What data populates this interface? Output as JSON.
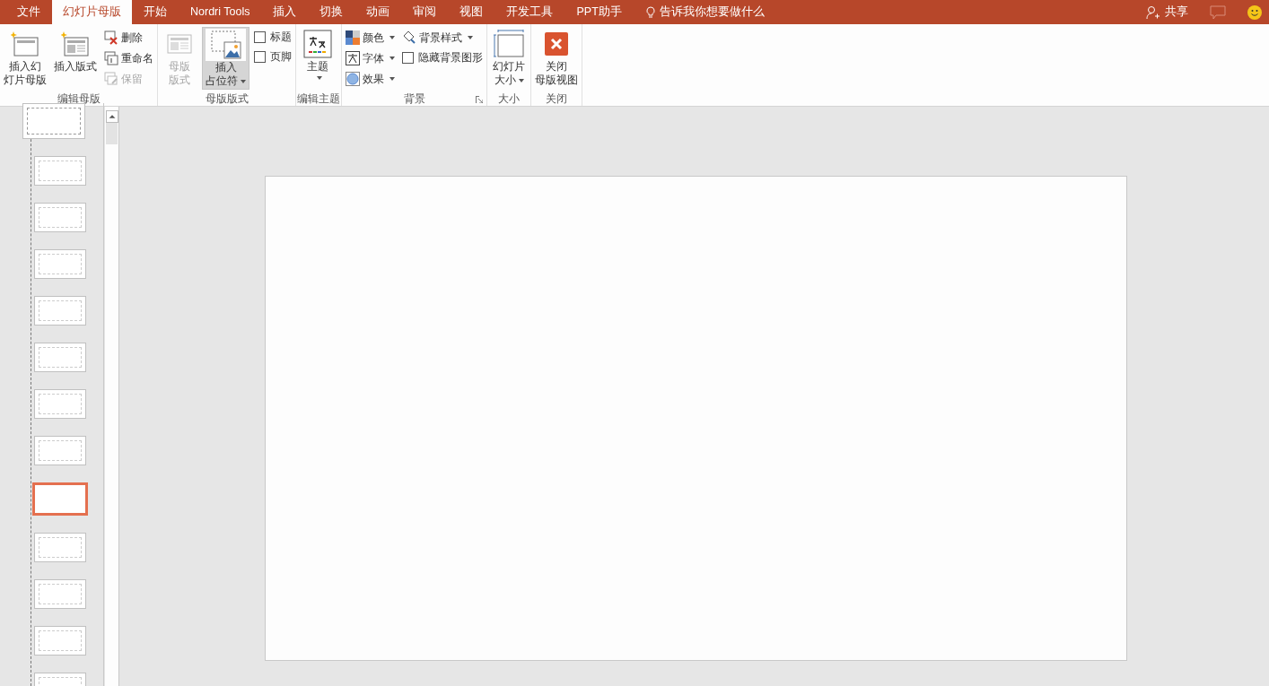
{
  "tabs": [
    {
      "label": "文件",
      "selected": false
    },
    {
      "label": "幻灯片母版",
      "selected": true
    },
    {
      "label": "开始",
      "selected": false
    },
    {
      "label": "Nordri Tools",
      "selected": false
    },
    {
      "label": "插入",
      "selected": false
    },
    {
      "label": "切换",
      "selected": false
    },
    {
      "label": "动画",
      "selected": false
    },
    {
      "label": "审阅",
      "selected": false
    },
    {
      "label": "视图",
      "selected": false
    },
    {
      "label": "开发工具",
      "selected": false
    },
    {
      "label": "PPT助手",
      "selected": false
    }
  ],
  "tell_me": "告诉我你想要做什么",
  "share": "共享",
  "ribbon_groups": [
    {
      "label": "编辑母版",
      "columns": [
        [
          {
            "kind": "large",
            "lines": [
              "插入幻",
              "灯片母版"
            ],
            "disabled": false,
            "dropdown": false,
            "pressed": false
          }
        ],
        [
          {
            "kind": "large",
            "lines": [
              "插入版式"
            ],
            "disabled": false,
            "dropdown": false,
            "pressed": false
          }
        ],
        [
          {
            "kind": "small",
            "label": "删除",
            "disabled": false,
            "dropdown": false
          },
          {
            "kind": "small",
            "label": "重命名",
            "disabled": false,
            "dropdown": false
          },
          {
            "kind": "small",
            "label": "保留",
            "disabled": true,
            "dropdown": false
          }
        ]
      ]
    },
    {
      "label": "母版版式",
      "columns": [
        [
          {
            "kind": "large",
            "lines": [
              "母版",
              "版式"
            ],
            "disabled": true,
            "dropdown": false,
            "pressed": false
          }
        ],
        [
          {
            "kind": "large",
            "lines": [
              "插入",
              "占位符"
            ],
            "disabled": false,
            "dropdown": true,
            "pressed": true
          }
        ],
        [
          {
            "kind": "check",
            "label": "标题",
            "checked": false
          },
          {
            "kind": "check",
            "label": "页脚",
            "checked": false
          }
        ]
      ]
    },
    {
      "label": "编辑主题",
      "columns": [
        [
          {
            "kind": "large",
            "lines": [
              "主题"
            ],
            "disabled": false,
            "dropdown": true,
            "pressed": false
          }
        ]
      ]
    },
    {
      "label": "背景",
      "launcher": true,
      "columns": [
        [
          {
            "kind": "small",
            "label": "颜色",
            "disabled": false,
            "dropdown": true
          },
          {
            "kind": "small",
            "label": "字体",
            "disabled": false,
            "dropdown": true
          },
          {
            "kind": "small",
            "label": "效果",
            "disabled": false,
            "dropdown": true
          }
        ],
        [
          {
            "kind": "small",
            "label": "背景样式",
            "disabled": false,
            "dropdown": true
          },
          {
            "kind": "check",
            "label": "隐藏背景图形",
            "checked": false
          }
        ]
      ]
    },
    {
      "label": "大小",
      "columns": [
        [
          {
            "kind": "large",
            "lines": [
              "幻灯片",
              "大小"
            ],
            "disabled": false,
            "dropdown": true,
            "pressed": false
          }
        ]
      ]
    },
    {
      "label": "关闭",
      "columns": [
        [
          {
            "kind": "large",
            "lines": [
              "关闭",
              "母版视图"
            ],
            "disabled": false,
            "dropdown": false,
            "pressed": false
          }
        ]
      ]
    }
  ],
  "thumbnails": [
    {
      "kind": "master",
      "selected": false
    },
    {
      "kind": "layout",
      "selected": false
    },
    {
      "kind": "layout",
      "selected": false
    },
    {
      "kind": "layout",
      "selected": false
    },
    {
      "kind": "layout",
      "selected": false
    },
    {
      "kind": "layout",
      "selected": false
    },
    {
      "kind": "layout",
      "selected": false
    },
    {
      "kind": "layout",
      "selected": false
    },
    {
      "kind": "layout",
      "selected": true
    },
    {
      "kind": "layout",
      "selected": false
    },
    {
      "kind": "layout",
      "selected": false
    },
    {
      "kind": "layout",
      "selected": false
    },
    {
      "kind": "layout",
      "selected": false
    }
  ]
}
